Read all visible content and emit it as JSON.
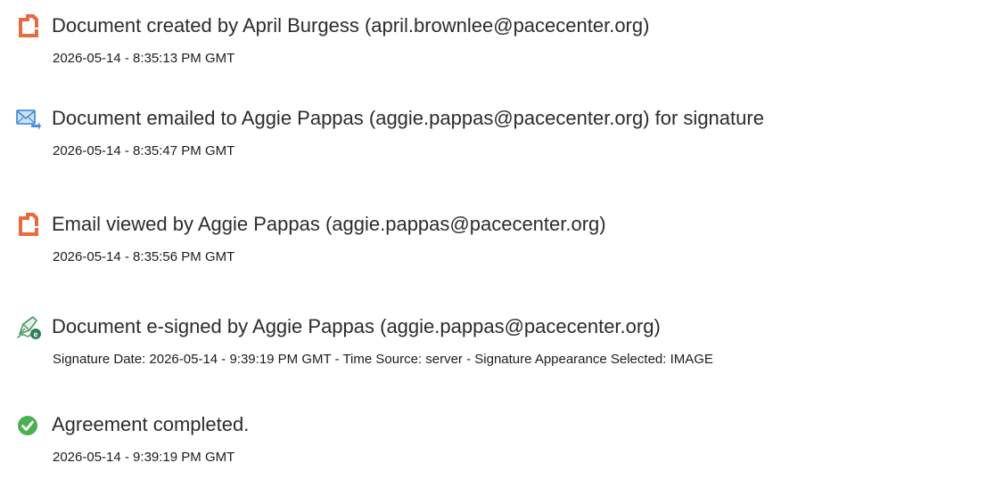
{
  "colors": {
    "document_icon": "#e86a3f",
    "email_icon": "#4a90d9",
    "sign_icon": "#5a9e6b",
    "sign_badge": "#2e7d5b",
    "complete_icon": "#4bb04f",
    "title_text": "#2c2c2c",
    "detail_text": "#1c1c1c"
  },
  "events": [
    {
      "icon": "document-icon",
      "title": "Document created by April Burgess (april.brownlee@pacecenter.org)",
      "detail": "2026-05-14 - 8:35:13 PM GMT"
    },
    {
      "icon": "email-sent-icon",
      "title": "Document emailed to Aggie Pappas (aggie.pappas@pacecenter.org) for signature",
      "detail": "2026-05-14 - 8:35:47 PM GMT"
    },
    {
      "icon": "document-icon",
      "title": "Email viewed by Aggie Pappas (aggie.pappas@pacecenter.org)",
      "detail": "2026-05-14 - 8:35:56 PM GMT"
    },
    {
      "icon": "esign-pen-icon",
      "title": "Document e-signed by Aggie Pappas (aggie.pappas@pacecenter.org)",
      "detail": "Signature Date: 2026-05-14 - 9:39:19 PM GMT - Time Source: server - Signature Appearance Selected: IMAGE"
    },
    {
      "icon": "checkmark-circle-icon",
      "title": "Agreement completed.",
      "detail": "2026-05-14 - 9:39:19 PM GMT"
    }
  ]
}
